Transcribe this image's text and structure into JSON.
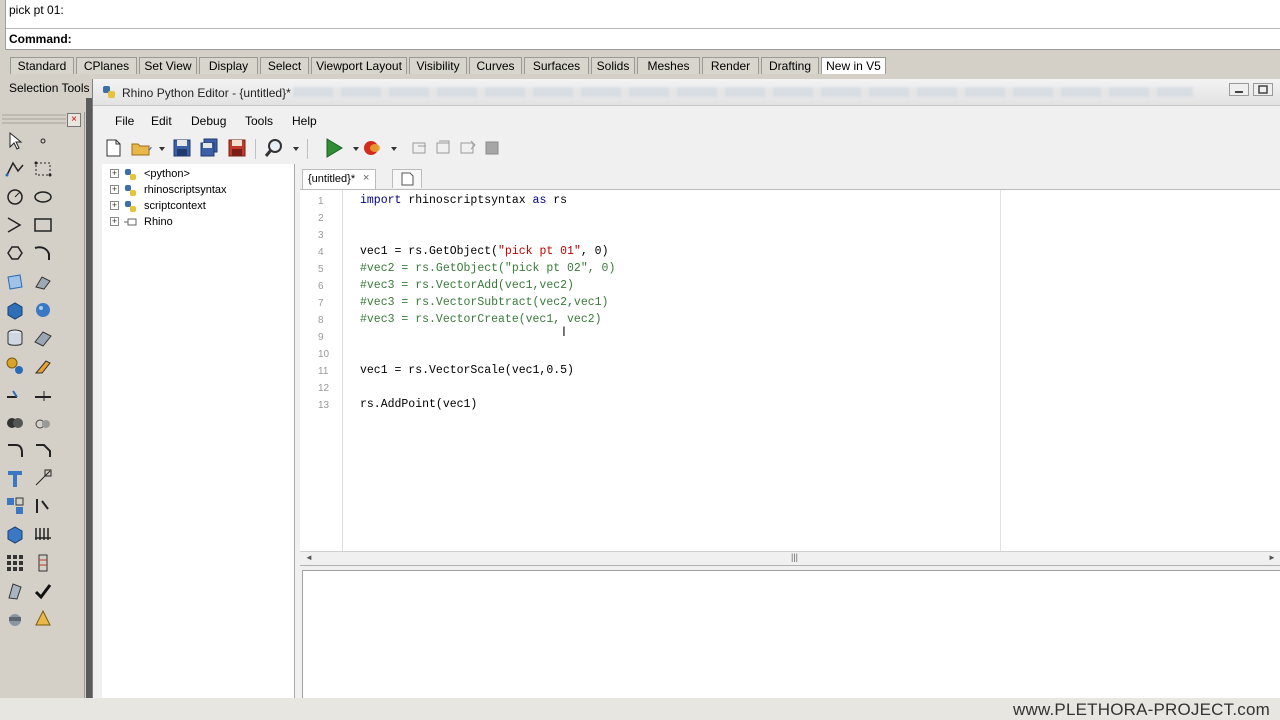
{
  "command_area": {
    "history_text": "pick pt 01:",
    "prompt_label": "Command:"
  },
  "toolbar_tabs": [
    {
      "label": "Standard"
    },
    {
      "label": "CPlanes"
    },
    {
      "label": "Set View"
    },
    {
      "label": "Display"
    },
    {
      "label": "Select"
    },
    {
      "label": "Viewport Layout"
    },
    {
      "label": "Visibility"
    },
    {
      "label": "Curves"
    },
    {
      "label": "Surfaces"
    },
    {
      "label": "Solids"
    },
    {
      "label": "Meshes"
    },
    {
      "label": "Render"
    },
    {
      "label": "Drafting"
    },
    {
      "label": "New in V5"
    }
  ],
  "active_tab": "New in V5",
  "selection_tools_label": "Selection Tools",
  "palette": {
    "close_glyph": "×",
    "tools": [
      "select-arrow-icon",
      "point-icon",
      "polyline-icon",
      "curve-control-points-icon",
      "circle-icon",
      "ellipse-icon",
      "arc-icon",
      "rectangle-icon",
      "polygon-icon",
      "freeform-curve-icon",
      "surface-corner-points-icon",
      "extrude-curve-icon",
      "box-solid-icon",
      "sphere-icon",
      "cylinder-icon",
      "planar-surface-icon",
      "transform-gear-icon",
      "trim-icon",
      "split-icon",
      "extend-icon",
      "boolean-union-icon",
      "boolean-difference-icon",
      "fillet-icon",
      "chamfer-icon",
      "text-icon",
      "dimension-icon",
      "array-icon",
      "blend-icon",
      "group-icon",
      "hatch-icon",
      "grid-icon",
      "layer-icon",
      "analyze-icon",
      "check-icon",
      "render-icon",
      "light-icon"
    ]
  },
  "editor": {
    "title": "Rhino Python Editor - {untitled}*",
    "menus": [
      "File",
      "Edit",
      "Debug",
      "Tools",
      "Help"
    ],
    "icons": [
      "new-file-icon",
      "open-folder-icon",
      "save-icon",
      "save-all-icon",
      "save-as-icon",
      "find-icon",
      "run-icon",
      "record-icon",
      "step-into-icon",
      "step-over-icon",
      "step-out-icon",
      "stop-icon"
    ],
    "tree": [
      {
        "label": "<python>",
        "icon": "python-icon"
      },
      {
        "label": "rhinoscriptsyntax",
        "icon": "python-icon"
      },
      {
        "label": "scriptcontext",
        "icon": "python-icon"
      },
      {
        "label": "Rhino",
        "icon": "namespace-icon"
      }
    ],
    "doc_tab": "{untitled}*",
    "doc_tab_close": "×",
    "code_lines": [
      {
        "n": "1",
        "segments": [
          {
            "t": "import",
            "c": "kw"
          },
          {
            "t": " rhinoscriptsyntax ",
            "c": ""
          },
          {
            "t": "as",
            "c": "kw"
          },
          {
            "t": " rs",
            "c": ""
          }
        ]
      },
      {
        "n": "2",
        "segments": []
      },
      {
        "n": "3",
        "segments": []
      },
      {
        "n": "4",
        "segments": [
          {
            "t": "vec1 = rs.GetObject(",
            "c": ""
          },
          {
            "t": "\"pick pt 01\"",
            "c": "str"
          },
          {
            "t": ", 0)",
            "c": ""
          }
        ]
      },
      {
        "n": "5",
        "segments": [
          {
            "t": "#vec2 = rs.GetObject(\"pick pt 02\", 0)",
            "c": "cmt"
          }
        ]
      },
      {
        "n": "6",
        "segments": [
          {
            "t": "#vec3 = rs.VectorAdd(vec1,vec2)",
            "c": "cmt"
          }
        ]
      },
      {
        "n": "7",
        "segments": [
          {
            "t": "#vec3 = rs.VectorSubtract(vec2,vec1)",
            "c": "cmt"
          }
        ]
      },
      {
        "n": "8",
        "segments": [
          {
            "t": "#vec3 = rs.VectorCreate(vec1, vec2)",
            "c": "cmt"
          }
        ]
      },
      {
        "n": "9",
        "segments": []
      },
      {
        "n": "10",
        "segments": []
      },
      {
        "n": "11",
        "segments": [
          {
            "t": "vec1 = rs.VectorScale(vec1,0.5)",
            "c": ""
          }
        ]
      },
      {
        "n": "12",
        "segments": []
      },
      {
        "n": "13",
        "segments": [
          {
            "t": "rs.AddPoint(vec1)",
            "c": ""
          }
        ]
      }
    ],
    "scroll_left": "◄",
    "scroll_right": "►",
    "scroll_grip": "|||"
  },
  "watermark": "www.PLETHORA-PROJECT.com"
}
